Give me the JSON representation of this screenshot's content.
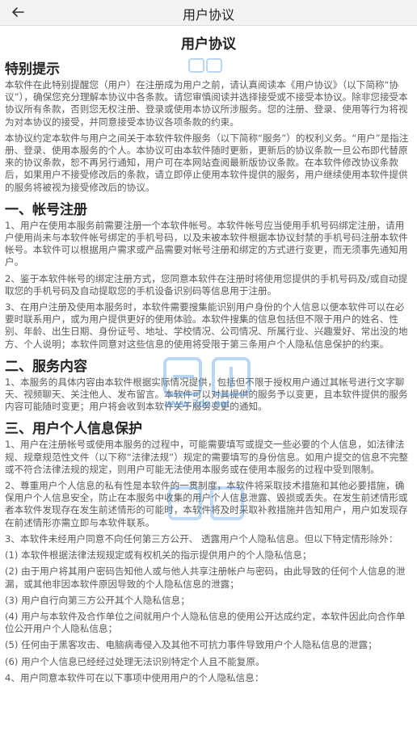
{
  "appbar": {
    "title": "用户协议"
  },
  "document": {
    "title": "用户协议",
    "special_heading": "特别提示",
    "special_paragraphs": [
      "本软件在此特别提醒您（用户）在注册成为用户之前，请认真阅读本《用户协议》（以下简称“协议”），确保您充分理解本协议中各条款。请您审慎阅读并选择接受或不接受本协议。除非您接受本协议所有条款，否则您无权注册、登录或使用本协议所涉服务。您的注册、登录、使用等行为将视为对本协议的接受，并同意接受本协议各项条款的约束。",
      "本协议约定本软件与用户之间关于本软件软件服务（以下简称“服务”）的权利义务。“用户”是指注册、登录、使用本服务的个人。本协议可由本软件随时更新，更新后的协议条款一旦公布即代替原来的协议条款，恕不再另行通知，用户可在本网站查阅最新版协议条款。在本软件修改协议条款后，如果用户不接受修改后的条款，请立即停止使用本软件提供的服务，用户继续使用本软件提供的服务将被视为接受修改后的协议。"
    ],
    "sections": [
      {
        "heading": "一、帐号注册",
        "paragraphs": [
          "1、用户在使用本服务前需要注册一个本软件帐号。本软件帐号应当使用手机号码绑定注册，请用户使用尚未与本软件帐号绑定的手机号码，以及未被本软件根据本协议封禁的手机号码注册本软件帐号。本软件可以根据用户需求或产品需要对帐号注册和绑定的方式进行变更，而无须事先通知用户。",
          "2、鉴于本软件帐号的绑定注册方式，您同意本软件在注册时将使用您提供的手机号码及/或自动提取您的手机号码及自动提取您的手机设备识别码等信息用于注册。",
          "3、在用户注册及使用本服务时，本软件需要搜集能识别用户身份的个人信息以便本软件可以在必要时联系用户，或为用户提供更好的使用体验。本软件搜集的信息包括但不限于用户的姓名、性别、年龄、出生日期、身份证号、地址、学校情况、公司情况、所属行业、兴趣爱好、常出没的地方、个人说明；本软件同意对这些信息的使用将受限于第三条用户个人隐私信息保护的约束。"
        ]
      },
      {
        "heading": "二、服务内容",
        "paragraphs": [
          "1、本服务的具体内容由本软件根据实际情况提供，包括但不限于授权用户通过其帐号进行文字聊天、视频聊天、关注他人、发布留言。本软件可以对其提供的服务予以变更，且本软件提供的服务内容可能随时变更；用户将会收到本软件关于服务变更的通知。"
        ]
      },
      {
        "heading": "三、用户个人信息保护",
        "paragraphs": [
          "1、用户在注册帐号或使用本服务的过程中，可能需要填写或提交一些必要的个人信息，如法律法规、规章规范性文件（以下称“法律法规”）规定的需要填写的身份信息。如用户提交的信息不完整或不符合法律法规的规定，则用户可能无法使用本服务或在使用本服务的过程中受到限制。",
          "2、尊重用户个人信息的私有性是本软件的一贯制度，本软件将采取技术措施和其他必要措施，确保用户个人信息安全，防止在本服务中收集的用户个人信息泄露、毁损或丢失。在发生前述情形或者本软件发现存在发生前述情形的可能时，本软件将及时采取补救措施并告知用户，用户如发现存在前述情形亦需立即与本软件联系。",
          "3、本软件未经用户同意不向任何第三方公开、 透露用户个人隐私信息。但以下特定情形除外：",
          "(1) 本软件根据法律法规规定或有权机关的指示提供用户的个人隐私信息；",
          "(2) 由于用户将其用户密码告知他人或与他人共享注册帐户与密码，由此导致的任何个人信息的泄漏，或其他非因本软件原因导致的个人隐私信息的泄露；",
          "(3) 用户自行向第三方公开其个人隐私信息；",
          "(4) 用户与本软件及合作单位之间就用户个人隐私信息的使用公开达成约定，本软件因此向合作单位公开用户个人隐私信息；",
          "(5) 任何由于黑客攻击、电脑病毒侵入及其他不可抗力事件导致用户个人隐私信息的泄露；",
          "(6) 用户个人信息已经经过处理无法识别特定个人且不能复原。",
          "4、用户同意本软件可在以下事项中使用用户的个人隐私信息："
        ]
      }
    ]
  },
  "watermark": {
    "url": "www.7do.net"
  },
  "colors": {
    "appbar_bg": "#f3f3f3",
    "text": "#5a5a5a",
    "heading": "#222222",
    "watermark": "#3a8be0"
  },
  "icons": {
    "back": "arrow-left-icon"
  }
}
